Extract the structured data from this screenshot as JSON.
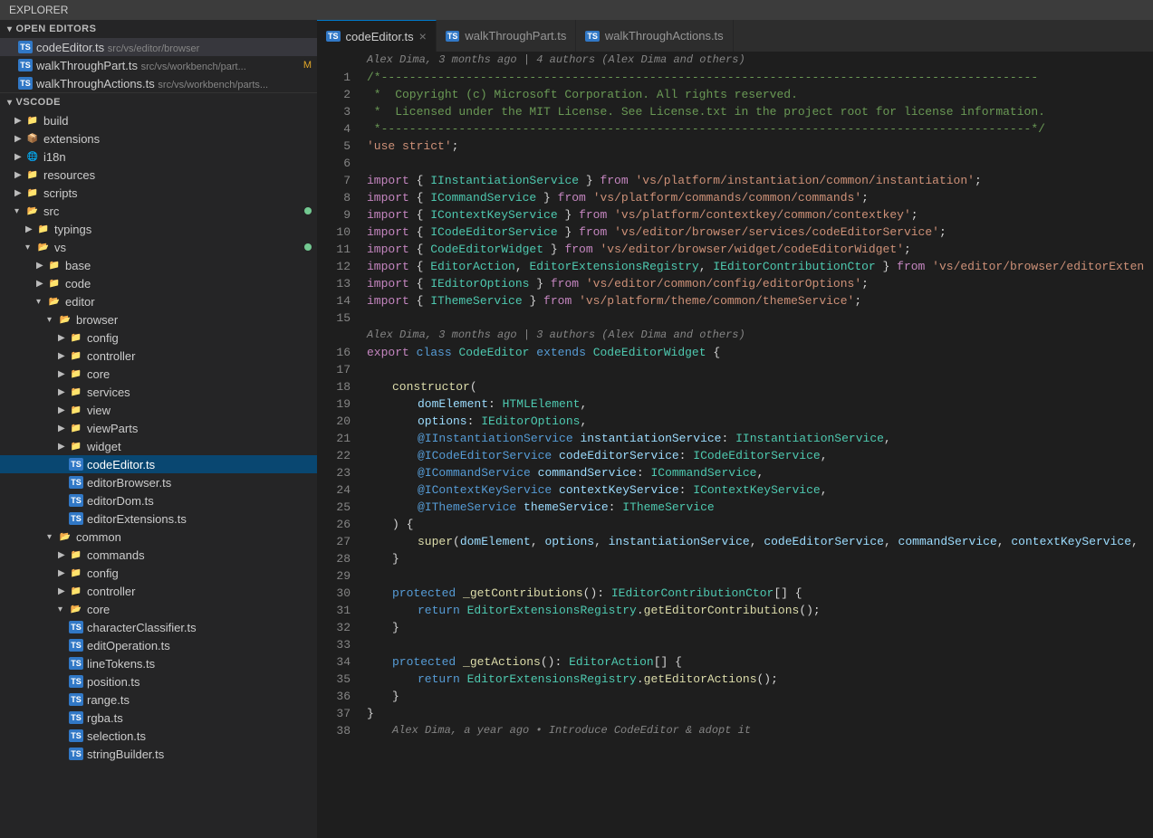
{
  "titleBar": {
    "label": "EXPLORER"
  },
  "sidebar": {
    "openEditors": {
      "header": "OPEN EDITORS",
      "items": [
        {
          "name": "codeEditor.ts",
          "path": "src/vs/editor/browser",
          "ts": true,
          "active": true
        },
        {
          "name": "walkThroughPart.ts",
          "path": "src/vs/workbench/part...",
          "ts": true,
          "badge": "M"
        },
        {
          "name": "walkThroughActions.ts",
          "path": "src/vs/workbench/parts...",
          "ts": true
        }
      ]
    },
    "vscode": {
      "header": "VSCODE",
      "tree": [
        {
          "indent": 0,
          "type": "folder",
          "name": "build",
          "open": false
        },
        {
          "indent": 0,
          "type": "folder",
          "name": "extensions",
          "open": false
        },
        {
          "indent": 0,
          "type": "folder",
          "name": "i18n",
          "open": false
        },
        {
          "indent": 0,
          "type": "folder",
          "name": "resources",
          "open": false
        },
        {
          "indent": 0,
          "type": "folder",
          "name": "scripts",
          "open": false
        },
        {
          "indent": 0,
          "type": "folder",
          "name": "src",
          "open": true,
          "badge": "dot-green"
        },
        {
          "indent": 1,
          "type": "folder",
          "name": "typings",
          "open": false
        },
        {
          "indent": 1,
          "type": "folder",
          "name": "vs",
          "open": true,
          "badge": "dot-green"
        },
        {
          "indent": 2,
          "type": "folder",
          "name": "base",
          "open": false
        },
        {
          "indent": 2,
          "type": "folder",
          "name": "code",
          "open": false
        },
        {
          "indent": 2,
          "type": "folder",
          "name": "editor",
          "open": true
        },
        {
          "indent": 3,
          "type": "folder",
          "name": "browser",
          "open": true
        },
        {
          "indent": 4,
          "type": "folder",
          "name": "config",
          "open": false
        },
        {
          "indent": 4,
          "type": "folder",
          "name": "controller",
          "open": false
        },
        {
          "indent": 4,
          "type": "folder",
          "name": "core",
          "open": false
        },
        {
          "indent": 4,
          "type": "folder",
          "name": "services",
          "open": false
        },
        {
          "indent": 4,
          "type": "folder",
          "name": "view",
          "open": false
        },
        {
          "indent": 4,
          "type": "folder",
          "name": "viewParts",
          "open": false
        },
        {
          "indent": 4,
          "type": "folder",
          "name": "widget",
          "open": false
        },
        {
          "indent": 4,
          "type": "file-ts",
          "name": "codeEditor.ts",
          "active": true,
          "selected": true
        },
        {
          "indent": 4,
          "type": "file-ts",
          "name": "editorBrowser.ts"
        },
        {
          "indent": 4,
          "type": "file-ts",
          "name": "editorDom.ts"
        },
        {
          "indent": 4,
          "type": "file-ts",
          "name": "editorExtensions.ts"
        },
        {
          "indent": 3,
          "type": "folder",
          "name": "common",
          "open": true
        },
        {
          "indent": 4,
          "type": "folder",
          "name": "commands",
          "open": false
        },
        {
          "indent": 4,
          "type": "folder",
          "name": "config",
          "open": false
        },
        {
          "indent": 4,
          "type": "folder",
          "name": "controller",
          "open": false
        },
        {
          "indent": 4,
          "type": "folder",
          "name": "core",
          "open": true
        },
        {
          "indent": 5,
          "type": "file-ts",
          "name": "characterClassifier.ts"
        },
        {
          "indent": 5,
          "type": "file-ts",
          "name": "editOperation.ts"
        },
        {
          "indent": 5,
          "type": "file-ts",
          "name": "lineTokens.ts"
        },
        {
          "indent": 5,
          "type": "file-ts",
          "name": "position.ts"
        },
        {
          "indent": 5,
          "type": "file-ts",
          "name": "range.ts"
        },
        {
          "indent": 5,
          "type": "file-ts",
          "name": "rgba.ts"
        },
        {
          "indent": 5,
          "type": "file-ts",
          "name": "selection.ts"
        },
        {
          "indent": 5,
          "type": "file-ts",
          "name": "stringBuilder.ts"
        }
      ]
    }
  },
  "tabs": [
    {
      "name": "codeEditor.ts",
      "active": true,
      "closable": true
    },
    {
      "name": "walkThroughPart.ts",
      "active": false
    },
    {
      "name": "walkThroughActions.ts",
      "active": false
    }
  ],
  "editor": {
    "blame1": "Alex Dima, 3 months ago | 4 authors (Alex Dima and others)",
    "blame2": "Alex Dima, 3 months ago | 3 authors (Alex Dima and others)",
    "blame3": "Alex Dima, a year ago • Introduce CodeEditor & adopt it"
  }
}
